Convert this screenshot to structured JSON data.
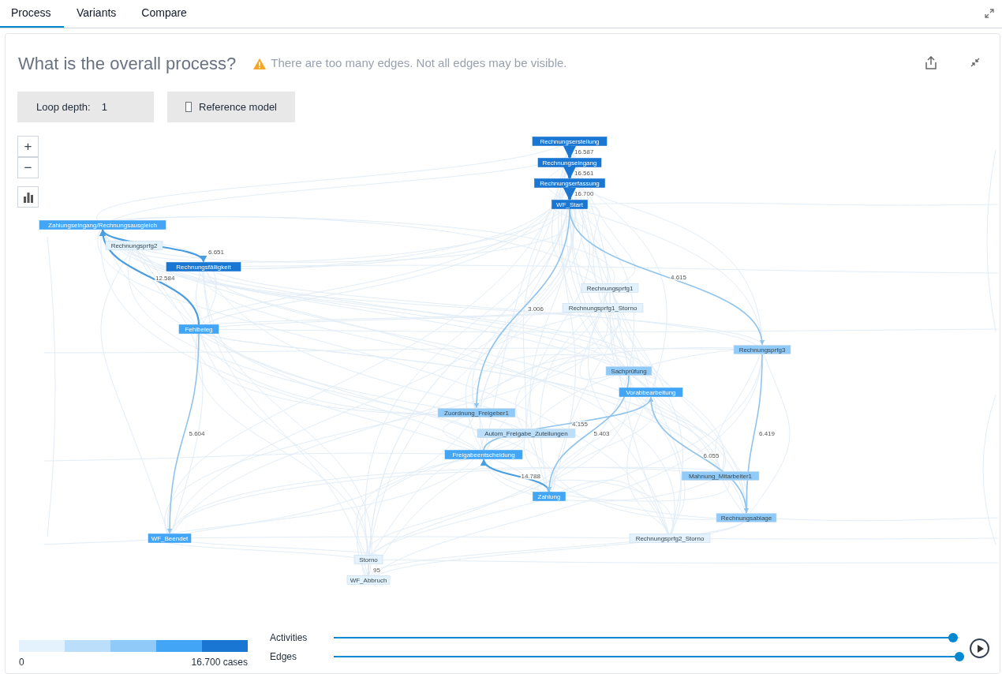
{
  "tabs": [
    {
      "label": "Process",
      "selected": true
    },
    {
      "label": "Variants",
      "selected": false
    },
    {
      "label": "Compare",
      "selected": false
    }
  ],
  "title": "What is the overall process?",
  "warning": "There are too many edges. Not all edges may be visible.",
  "loop_depth": {
    "label": "Loop depth:",
    "value": "1"
  },
  "reference_model": {
    "label": "Reference model",
    "checked": false
  },
  "zoom_controls": [
    "+",
    "−"
  ],
  "nodes": [
    {
      "label": "Rechnungserstellung",
      "color": "#1976d2"
    },
    {
      "label": "Rechnungseingang",
      "color": "#1976d2"
    },
    {
      "label": "Rechnungserfassung",
      "color": "#1976d2"
    },
    {
      "label": "WF_Start",
      "color": "#1976d2"
    },
    {
      "label": "Zahlungseingang/Rechnungsausgleich",
      "color": "#42a5f5"
    },
    {
      "label": "Rechnungsprfg2",
      "color": "#e3f2fd"
    },
    {
      "label": "Rechnungsfälligkeit",
      "color": "#1976d2"
    },
    {
      "label": "Fehlbeleg",
      "color": "#42a5f5"
    },
    {
      "label": "Rechnungsprfg1",
      "color": "#e3f2fd"
    },
    {
      "label": "Rechnungsprfg1_Storno",
      "color": "#e3f2fd"
    },
    {
      "label": "Rechnungsprfg3",
      "color": "#90caf9"
    },
    {
      "label": "Sachprüfung",
      "color": "#90caf9"
    },
    {
      "label": "Vorabbearbeitung",
      "color": "#42a5f5"
    },
    {
      "label": "Zuordnung_Freigeber1",
      "color": "#90caf9"
    },
    {
      "label": "Autom_Freigabe_Zuteilungen",
      "color": "#bbdefb"
    },
    {
      "label": "Freigabeentscheidung",
      "color": "#42a5f5"
    },
    {
      "label": "Zahlung",
      "color": "#42a5f5"
    },
    {
      "label": "Mahnung_Mitarbeiter1",
      "color": "#90caf9"
    },
    {
      "label": "Rechnungsablage",
      "color": "#90caf9"
    },
    {
      "label": "WF_Beendet",
      "color": "#42a5f5"
    },
    {
      "label": "Rechnungsprfg2_Storno",
      "color": "#e3f2fd"
    },
    {
      "label": "Storno",
      "color": "#e3f2fd"
    },
    {
      "label": "WF_Abbruch",
      "color": "#e3f2fd"
    }
  ],
  "edges": [
    {
      "label": "16.587",
      "kind": "strong"
    },
    {
      "label": "16.561",
      "kind": "strong"
    },
    {
      "label": "16.700",
      "kind": "strong"
    },
    {
      "label": "6.651",
      "kind": "medium"
    },
    {
      "label": "12.584",
      "kind": "medium"
    },
    {
      "label": "14.788",
      "kind": "medium"
    },
    {
      "label": "4.615",
      "kind": "light"
    },
    {
      "label": "6.419",
      "kind": "light"
    },
    {
      "label": "6.055",
      "kind": "light"
    },
    {
      "label": "5.403",
      "kind": "light"
    },
    {
      "label": "3.006",
      "kind": "light"
    },
    {
      "label": "5.604",
      "kind": "light"
    },
    {
      "label": "4.155",
      "kind": "light"
    },
    {
      "label": "95",
      "kind": "faint"
    }
  ],
  "legend": {
    "min": "0",
    "max": "16.700 cases",
    "steps": [
      {
        "color": "#e3f2fd"
      },
      {
        "color": "#bbdefb"
      },
      {
        "color": "#90caf9"
      },
      {
        "color": "#42a5f5"
      },
      {
        "color": "#1976d2"
      }
    ]
  },
  "sliders": [
    {
      "label": "Activities",
      "level": 0.99
    },
    {
      "label": "Edges",
      "level": 1
    }
  ]
}
